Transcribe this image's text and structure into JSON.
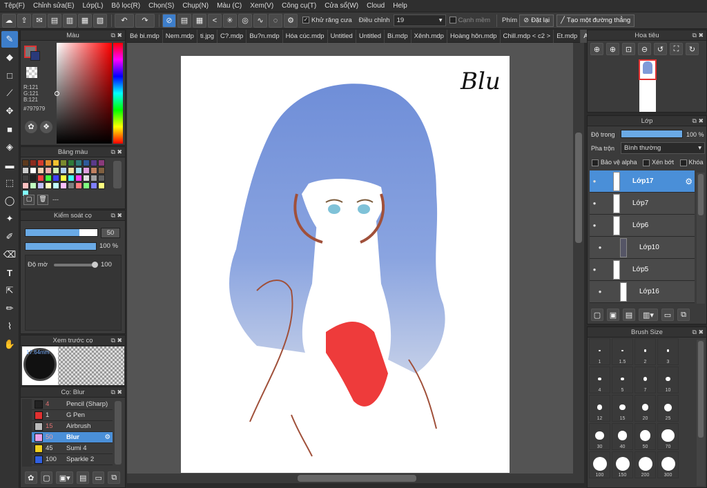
{
  "menu": [
    "Tệp(F)",
    "Chỉnh sửa(E)",
    "Lớp(L)",
    "Bộ lọc(R)",
    "Chọn(S)",
    "Chụp(N)",
    "Màu (C)",
    "Xem(V)",
    "Công cụ(T)",
    "Cửa sổ(W)",
    "Cloud",
    "Help"
  ],
  "toolbar": {
    "antialias_label": "Khử răng cưa",
    "adjust_label": "Điều chỉnh",
    "adjust_value": "19",
    "edge_label": "Cạnh mềm",
    "key_label": "Phím",
    "reset_label": "Đặt lại",
    "line_label": "Tạo một đường thẳng"
  },
  "color_panel": {
    "title": "Màu",
    "r": "R:121",
    "g": "G:121",
    "b": "B:121",
    "hex": "#797979",
    "main_color": "#797979"
  },
  "palette_panel": {
    "title": "Bảng màu",
    "name": "---",
    "colors": [
      "#5c3a1e",
      "#8b2a1e",
      "#d23c2e",
      "#e08a2e",
      "#f2c230",
      "#7a8a2e",
      "#2e7a3a",
      "#2e7a7a",
      "#2e5a9a",
      "#5a3a8a",
      "#8a3a7a",
      "#cccccc",
      "#ffffff",
      "#f0d0b0",
      "#f0b0b0",
      "#d0f0b0",
      "#b0d0f0",
      "#f0e0a0",
      "#a0e0f0",
      "#e0a0e0",
      "#c08060",
      "#806040",
      "#404040",
      "#202020",
      "#ff4040",
      "#40ff40",
      "#4040ff",
      "#ffff40",
      "#40ffff",
      "#ff40ff",
      "#e0e0e0",
      "#a0a0a0",
      "#606060",
      "#ffc0c0",
      "#c0ffc0",
      "#c0c0ff",
      "#ffffc0",
      "#c0ffff",
      "#ffc0ff",
      "#808080",
      "#ff8080",
      "#80ff80",
      "#8080ff",
      "#ffff80",
      "#80ffff"
    ]
  },
  "brush_control": {
    "title": "Kiểm soát cọ",
    "size": "50",
    "opacity": "100 %",
    "opacity_fraction": 1.0,
    "size_fraction": 0.75,
    "blur_label": "Độ mờ",
    "blur_value": "100",
    "blur_fraction": 1.0
  },
  "brush_preview": {
    "title": "Xem trước cọ",
    "size_label": "17.64mm"
  },
  "brush_list": {
    "title": "Cọ: Blur",
    "items": [
      {
        "num": "4",
        "name": "Pencil (Sharp)",
        "color": "#222222"
      },
      {
        "num": "1",
        "name": "G Pen",
        "color": "#e03030"
      },
      {
        "num": "15",
        "name": "Airbrush",
        "color": "#bbbbbb"
      },
      {
        "num": "50",
        "name": "Blur",
        "color": "#e8a0e8"
      },
      {
        "num": "45",
        "name": "Sumi 4",
        "color": "#f0d020"
      },
      {
        "num": "100",
        "name": "Sparkle 2",
        "color": "#3060e0"
      }
    ]
  },
  "tabs": [
    "Bé bi.mdp",
    "Nem.mdp",
    "ti.jpg",
    "C?.mdp",
    "Bu?n.mdp",
    "Hóa cúc.mdp",
    "Untitled",
    "Untitled",
    "Bi.mdp",
    "Xênh.mdp",
    "Hoàng hôn.mdp",
    "Chill.mdp < c2 >",
    "Et.mdp",
    "Ani.mdp"
  ],
  "canvas": {
    "signature": "Blu"
  },
  "navigator": {
    "title": "Hoa tiêu"
  },
  "layers": {
    "title": "Lớp",
    "opacity_label": "Độ trong",
    "opacity_value": "100 %",
    "blend_label": "Pha trộn",
    "blend_value": "Bình thường",
    "protect_alpha": "Bảo vệ alpha",
    "clipping": "Xén bớt",
    "lock": "Khóa",
    "items": [
      "Lớp17",
      "Lớp7",
      "Lớp6",
      "Lớp10",
      "Lớp5",
      "Lớp16"
    ]
  },
  "brush_size": {
    "title": "Brush Size",
    "sizes": [
      "1",
      "1.5",
      "2",
      "3",
      "4",
      "5",
      "7",
      "10",
      "12",
      "15",
      "20",
      "25",
      "30",
      "40",
      "50",
      "70",
      "100",
      "150",
      "200",
      "300"
    ]
  }
}
